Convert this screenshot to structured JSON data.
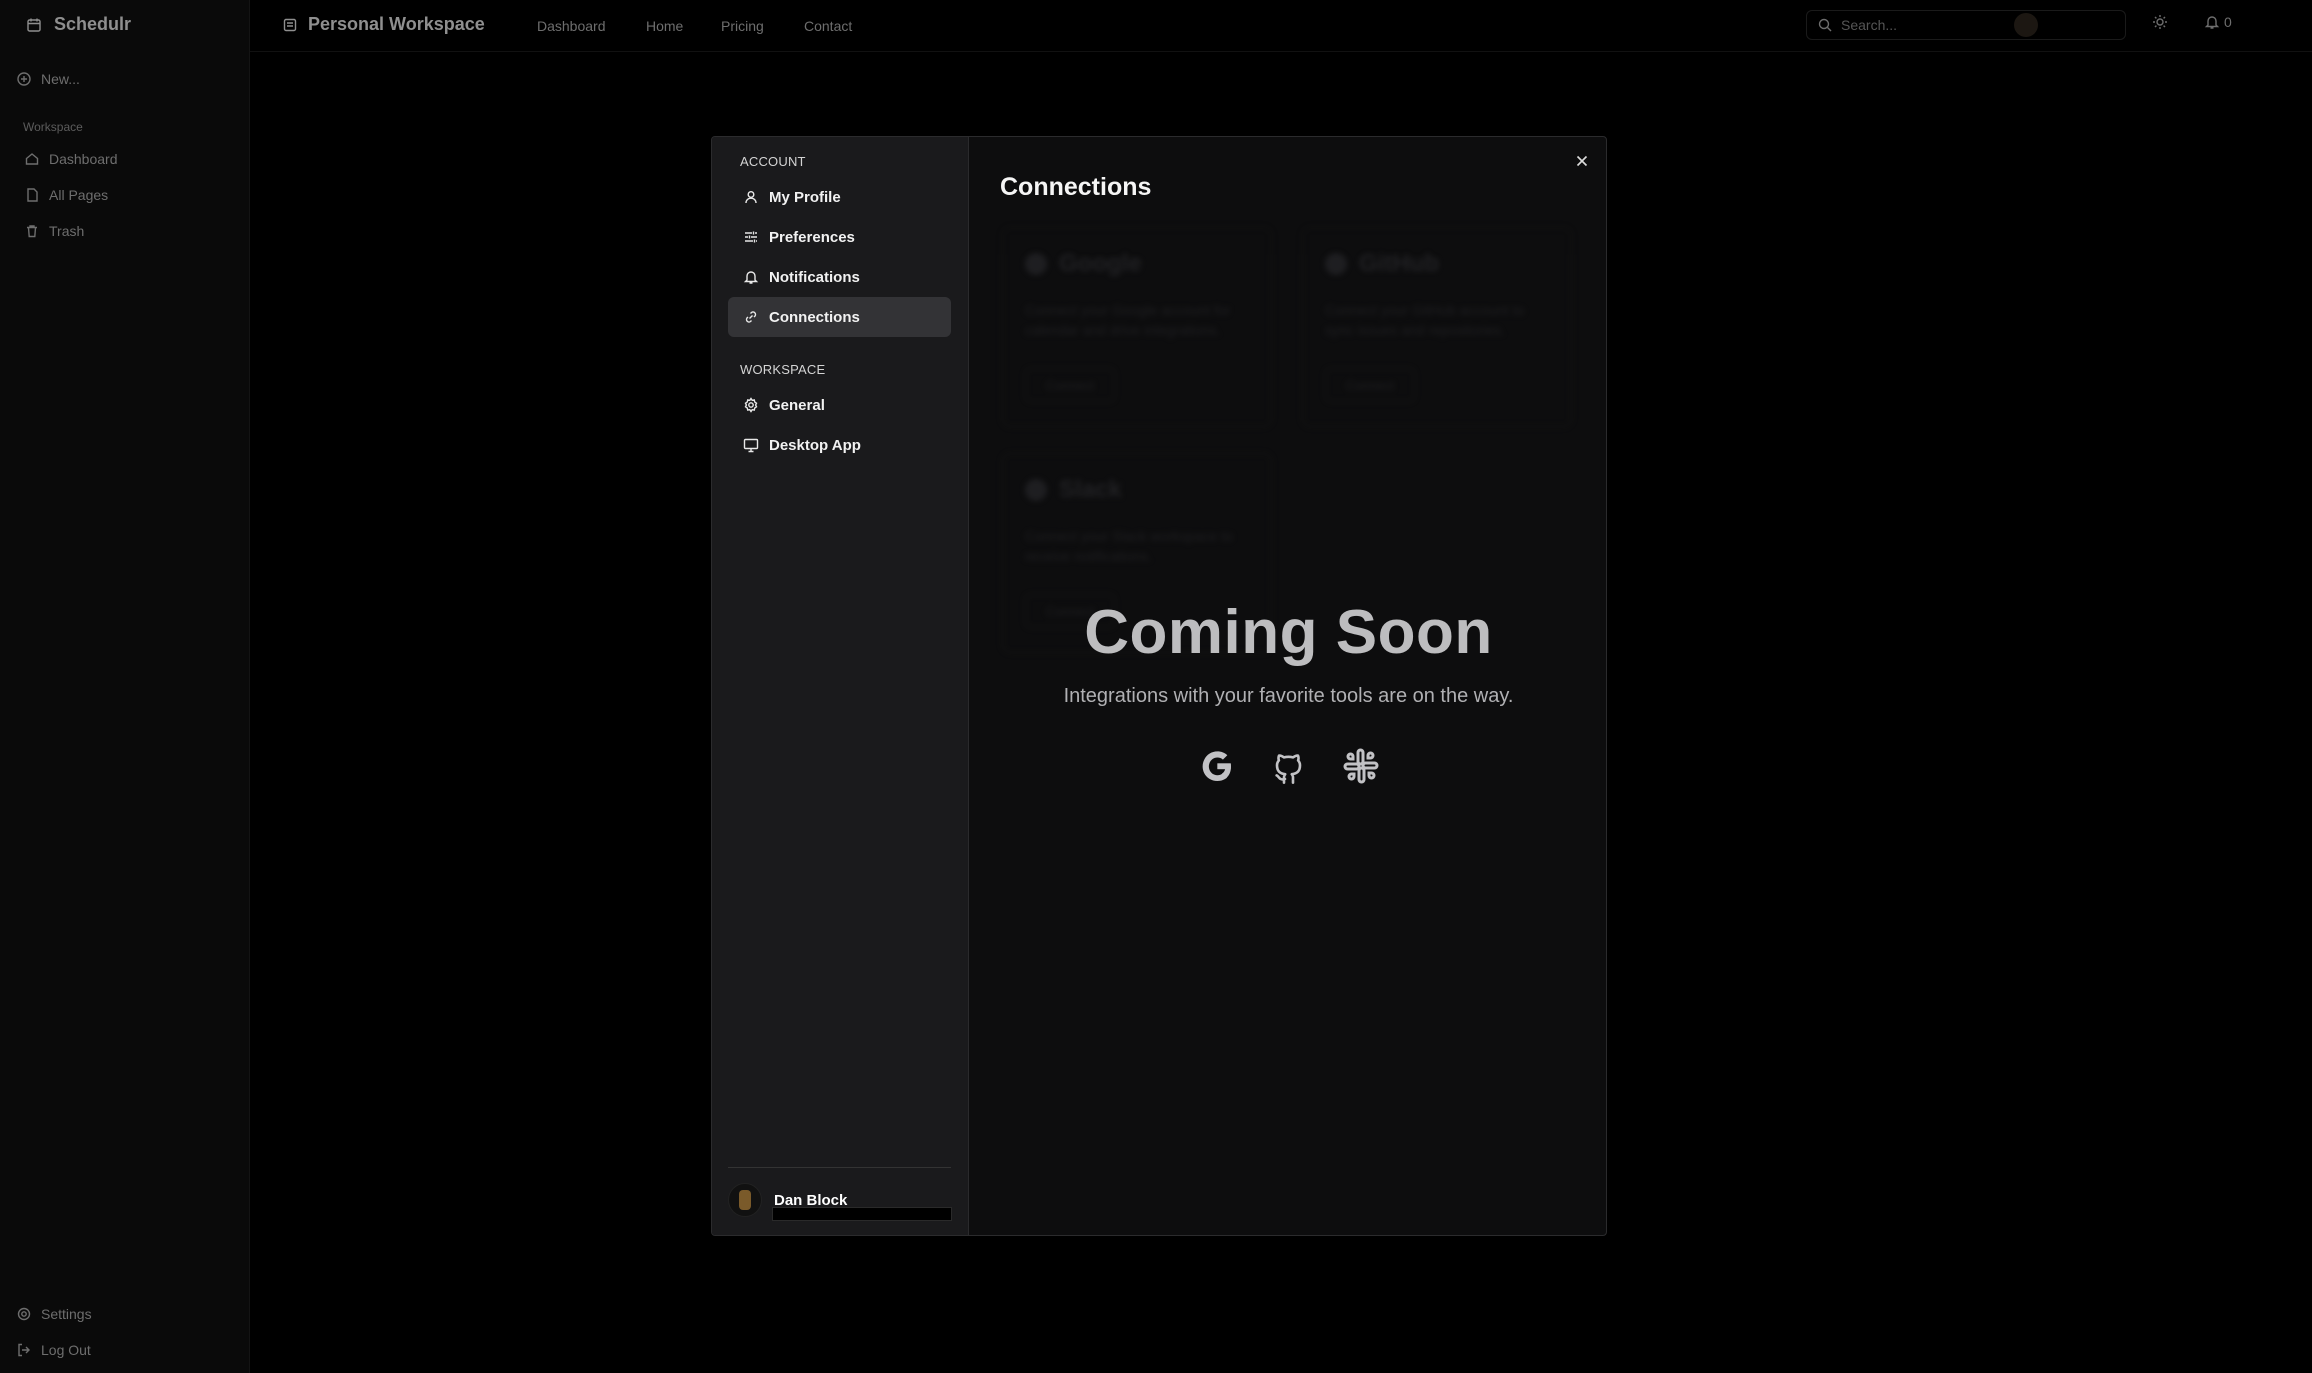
{
  "app": {
    "brand": "Schedulr",
    "new_label": "New...",
    "workspace_heading": "Workspace",
    "sidebar_items": [
      "Dashboard",
      "All Pages",
      "Trash"
    ],
    "settings_label": "Settings",
    "logout_label": "Log Out",
    "workspace_title": "Personal Workspace",
    "nav": [
      "Dashboard",
      "Home",
      "Pricing",
      "Contact"
    ],
    "search_placeholder": "Search...",
    "notification_count": "0"
  },
  "modal": {
    "account_heading": "ACCOUNT",
    "account_items": [
      "My Profile",
      "Preferences",
      "Notifications",
      "Connections"
    ],
    "active_item": "Connections",
    "workspace_heading": "WORKSPACE",
    "workspace_items": [
      "General",
      "Desktop App"
    ],
    "user_name": "Dan Block",
    "title": "Connections",
    "cards": [
      {
        "name": "Google",
        "desc": "Connect your Google account for calendar and drive integrations.",
        "button": "Connect"
      },
      {
        "name": "GitHub",
        "desc": "Connect your GitHub account to sync issues and repositories.",
        "button": "Connect"
      },
      {
        "name": "Slack",
        "desc": "Connect your Slack workspace to receive notifications.",
        "button": "Connect"
      }
    ],
    "coming_soon_title": "Coming Soon",
    "coming_soon_subtitle": "Integrations with your favorite tools are on the way.",
    "icons": [
      "google-icon",
      "github-icon",
      "slack-icon"
    ]
  }
}
